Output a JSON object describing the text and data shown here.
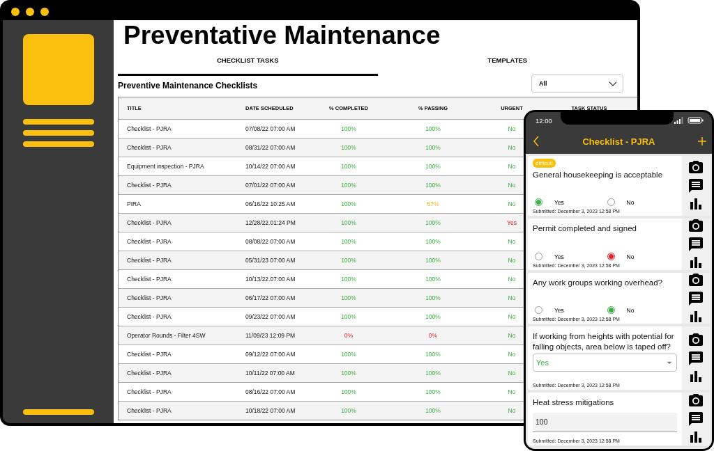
{
  "desktop": {
    "title": "Preventative Maintenance",
    "tabs": [
      {
        "label": "CHECKLIST TASKS",
        "selected": true
      },
      {
        "label": "TEMPLATES",
        "selected": false
      }
    ],
    "section_title": "Preventive Maintenance Checklists",
    "template_filter": {
      "value": "All"
    },
    "table": {
      "columns": [
        "TITLE",
        "DATE SCHEDULED",
        "% COMPLETED",
        "% PASSING",
        "URGENT",
        "TASK STATUS"
      ],
      "rows": [
        {
          "title": "Checklist - PJRA",
          "date": "07/08/22 07:00 AM",
          "completed": {
            "text": "100%",
            "ok": true,
            "warning": false
          },
          "passing": {
            "text": "100%",
            "ok": true,
            "warning": false
          },
          "urgent": {
            "text": "No",
            "ok": true,
            "warning": false
          }
        },
        {
          "title": "Checklist - PJRA",
          "date": "08/31/22 07:00 AM",
          "completed": {
            "text": "100%",
            "ok": true,
            "warning": false
          },
          "passing": {
            "text": "100%",
            "ok": true,
            "warning": false
          },
          "urgent": {
            "text": "No",
            "ok": true,
            "warning": false
          }
        },
        {
          "title": "Equipment inspection  - PJRA",
          "date": "10/14/22 07:00 AM",
          "completed": {
            "text": "100%",
            "ok": true,
            "warning": false
          },
          "passing": {
            "text": "100%",
            "ok": true,
            "warning": false
          },
          "urgent": {
            "text": "No",
            "ok": true,
            "warning": false
          }
        },
        {
          "title": "Checklist - PJRA",
          "date": "07/01/22 07:00 AM",
          "completed": {
            "text": "100%",
            "ok": true,
            "warning": false
          },
          "passing": {
            "text": "100%",
            "ok": true,
            "warning": false
          },
          "urgent": {
            "text": "No",
            "ok": true,
            "warning": false
          }
        },
        {
          "title": "PIRA",
          "date": "06/16/22 10:25 AM",
          "completed": {
            "text": "100%",
            "ok": true,
            "warning": false
          },
          "passing": {
            "text": "67%",
            "ok": false,
            "warning": true
          },
          "urgent": {
            "text": "No",
            "ok": true,
            "warning": false
          }
        },
        {
          "title": "Checklist - PJRA",
          "date": "12/28/22.01:24 PM",
          "completed": {
            "text": "100%",
            "ok": true,
            "warning": false
          },
          "passing": {
            "text": "100%",
            "ok": true,
            "warning": false
          },
          "urgent": {
            "text": "Yes",
            "ok": false,
            "warning": false
          }
        },
        {
          "title": "Checklist - PJRA",
          "date": "08/08/22 07:00 AM",
          "completed": {
            "text": "100%",
            "ok": true,
            "warning": false
          },
          "passing": {
            "text": "100%",
            "ok": true,
            "warning": false
          },
          "urgent": {
            "text": "No",
            "ok": true,
            "warning": false
          }
        },
        {
          "title": "Checklist - PJRA",
          "date": "05/31/23 07:00 AM",
          "completed": {
            "text": "100%",
            "ok": true,
            "warning": false
          },
          "passing": {
            "text": "100%",
            "ok": true,
            "warning": false
          },
          "urgent": {
            "text": "No",
            "ok": true,
            "warning": false
          }
        },
        {
          "title": "Checklist - PJRA",
          "date": "10/13/22.07:00 AM",
          "completed": {
            "text": "100%",
            "ok": true,
            "warning": false
          },
          "passing": {
            "text": "100%",
            "ok": true,
            "warning": false
          },
          "urgent": {
            "text": "No",
            "ok": true,
            "warning": false
          }
        },
        {
          "title": "Checklist - PJRA",
          "date": "06/17/22 07:00 AM",
          "completed": {
            "text": "100%",
            "ok": true,
            "warning": false
          },
          "passing": {
            "text": "100%",
            "ok": true,
            "warning": false
          },
          "urgent": {
            "text": "No",
            "ok": true,
            "warning": false
          }
        },
        {
          "title": "Checklist - PJRA",
          "date": "09/23/22 07:00 AM",
          "completed": {
            "text": "100%",
            "ok": true,
            "warning": false
          },
          "passing": {
            "text": "100%",
            "ok": true,
            "warning": false
          },
          "urgent": {
            "text": "No",
            "ok": true,
            "warning": false
          }
        },
        {
          "title": "Operator Rounds - Filter 4SW",
          "date": "11/09/23 12:09 PM",
          "completed": {
            "text": "0%",
            "ok": false,
            "warning": false
          },
          "passing": {
            "text": "0%",
            "ok": false,
            "warning": false
          },
          "urgent": {
            "text": "No",
            "ok": true,
            "warning": false
          }
        },
        {
          "title": "Checklist - PJRA",
          "date": "09/12/22 07:00 AM",
          "completed": {
            "text": "100%",
            "ok": true,
            "warning": false
          },
          "passing": {
            "text": "100%",
            "ok": true,
            "warning": false
          },
          "urgent": {
            "text": "No",
            "ok": true,
            "warning": false
          }
        },
        {
          "title": "Checklist - PJRA",
          "date": "10/11/22 07:00 AM",
          "completed": {
            "text": "100%",
            "ok": true,
            "warning": false
          },
          "passing": {
            "text": "100%",
            "ok": true,
            "warning": false
          },
          "urgent": {
            "text": "No",
            "ok": true,
            "warning": false
          }
        },
        {
          "title": "Checklist - PJRA",
          "date": "08/16/22 07:00 AM",
          "completed": {
            "text": "100%",
            "ok": true,
            "warning": false
          },
          "passing": {
            "text": "100%",
            "ok": true,
            "warning": false
          },
          "urgent": {
            "text": "No",
            "ok": true,
            "warning": false
          }
        },
        {
          "title": "Checklist - PJRA",
          "date": "10/18/22 07:00 AM",
          "completed": {
            "text": "100%",
            "ok": true,
            "warning": false
          },
          "passing": {
            "text": "100%",
            "ok": true,
            "warning": false
          },
          "urgent": {
            "text": "No",
            "ok": true,
            "warning": false
          }
        }
      ]
    }
  },
  "phone": {
    "time": "12:00",
    "title": "Checklist - PJRA",
    "questions": [
      {
        "kind": "radio",
        "tag": "difficult",
        "text": "General housekeeping is acceptable",
        "options": [
          {
            "label": "Yes",
            "selected": true
          },
          {
            "label": "No",
            "selected": false
          }
        ],
        "color": "#3cb043",
        "submitted": "Submitted: December 3, 2023 12:58 PM"
      },
      {
        "kind": "radio",
        "text": "Permit completed and signed",
        "options": [
          {
            "label": "Yes",
            "selected": false
          },
          {
            "label": "No",
            "selected": true
          }
        ],
        "color": "#e8202a",
        "submitted": "Submitted: December 3, 2023 12:58 PM"
      },
      {
        "kind": "radio",
        "text": "Any work groups working overhead?",
        "options": [
          {
            "label": "Yes",
            "selected": false
          },
          {
            "label": "No",
            "selected": true
          }
        ],
        "color": "#3cb043",
        "submitted": "Submitted: December 3, 2023 12:58 PM"
      },
      {
        "kind": "select",
        "text": "If working from heights with potential for falling objects, area below is taped off?",
        "value": "Yes",
        "submitted": "Submitted: December 3, 2023 12:58 PM"
      },
      {
        "kind": "number",
        "text": "Heat stress mitigations",
        "value": "100",
        "submitted": "Submitted: December 3, 2023 12:58 PM"
      }
    ]
  }
}
